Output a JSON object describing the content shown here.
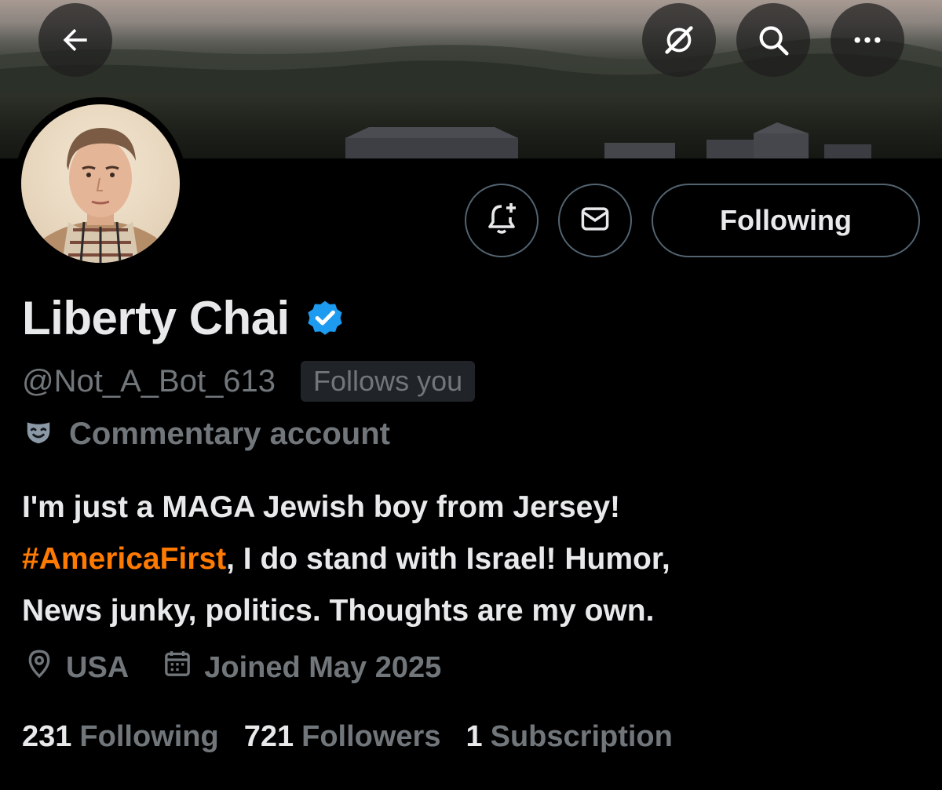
{
  "profile": {
    "display_name": "Liberty Chai",
    "handle": "@Not_A_Bot_613",
    "follows_you_badge": "Follows you",
    "account_label": "Commentary account",
    "bio_line1": "I'm just a MAGA Jewish boy from Jersey!",
    "bio_hashtag": "#AmericaFirst",
    "bio_line2_rest": ", I do stand with Israel! Humor,",
    "bio_line3": "News junky, politics. Thoughts are my own.",
    "location": "USA",
    "joined": "Joined May 2025"
  },
  "actions": {
    "following_label": "Following"
  },
  "stats": {
    "following_count": "231",
    "following_label": "Following",
    "followers_count": "721",
    "followers_label": "Followers",
    "subscriptions_count": "1",
    "subscriptions_label": "Subscription"
  },
  "icons": {
    "back": "back-arrow-icon",
    "grok": "grok-icon",
    "search": "search-icon",
    "more": "more-icon",
    "notify": "bell-plus-icon",
    "message": "envelope-icon",
    "verified": "verified-badge-icon",
    "label": "mask-icon",
    "location": "location-pin-icon",
    "calendar": "calendar-icon"
  },
  "colors": {
    "background": "#000000",
    "primary_text": "#e7e9ea",
    "secondary_text": "#71767b",
    "hashtag": "#ff7a00",
    "verified": "#1d9bf0",
    "button_border": "#536471"
  }
}
